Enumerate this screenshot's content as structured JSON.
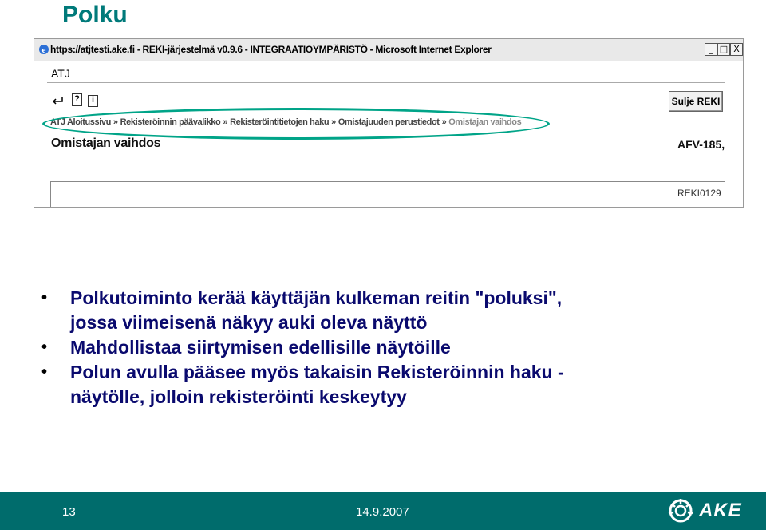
{
  "slide": {
    "title": "Polku"
  },
  "window": {
    "title": "https://atjtesti.ake.fi - REKI-järjestelmä v0.9.6 - INTEGRAATIOYMPÄRISTÖ - Microsoft Internet Explorer",
    "controls": [
      "_",
      "□",
      "X"
    ],
    "app_logo": "ATJ",
    "help_label": "?",
    "info_label": "i",
    "close_button_label": "Sulje REKI",
    "breadcrumb": [
      "ATJ Aloitussivu",
      "Rekisteröinnin päävalikko",
      "Rekisteröintitietojen haku",
      "Omistajuuden perustiedot",
      "Omistajan vaihdos"
    ],
    "breadcrumb_separator": "»",
    "page_heading": "Omistajan vaihdos",
    "vehicle_id": "AFV-185,",
    "screen_code": "REKI0129",
    "highlight_color": "#00a488"
  },
  "bullets": [
    {
      "lines": [
        "Polkutoiminto kerää käyttäjän kulkeman reitin \"poluksi\",",
        "jossa viimeisenä näkyy auki oleva näyttö"
      ]
    },
    {
      "lines": [
        "Mahdollistaa siirtymisen edellisille näytöille"
      ]
    },
    {
      "lines": [
        "Polun avulla pääsee myös takaisin Rekisteröinnin haku -",
        "näytölle, jolloin rekisteröinti keskeytyy"
      ]
    }
  ],
  "footer": {
    "page_number": "13",
    "date": "14.9.2007",
    "logo_text": "AKE",
    "background": "#006c6c"
  }
}
